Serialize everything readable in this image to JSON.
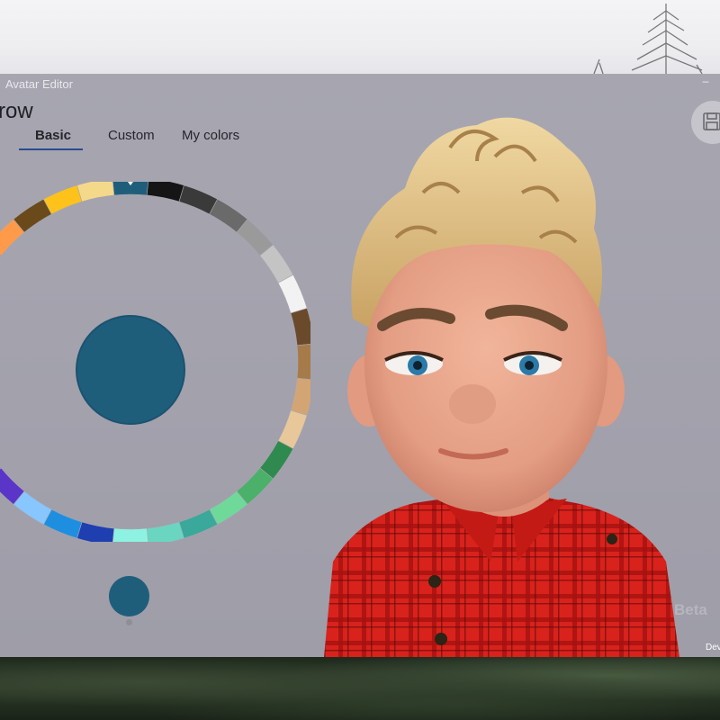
{
  "window": {
    "app_title": "Avatar Editor",
    "page_title": "rrow",
    "minimize_glyph": "–"
  },
  "tabs": [
    {
      "label": "Basic",
      "selected": true
    },
    {
      "label": "Custom",
      "selected": false
    },
    {
      "label": "My colors",
      "selected": false
    }
  ],
  "color_picker": {
    "selected_color": "#1f5e7b",
    "swatches": [
      "#1f5e7b",
      "#151515",
      "#3a3a3a",
      "#6a6a6a",
      "#9a9a9a",
      "#c4c4c4",
      "#f2f2f2",
      "#6a4a2a",
      "#a67b4a",
      "#d4a574",
      "#e8c89a",
      "#2f8a4f",
      "#4bb06a",
      "#6fd99a",
      "#3aa89a",
      "#6ad6c2",
      "#8ef2e2",
      "#1f3fb0",
      "#1e8fe0",
      "#88c6ff",
      "#5a35c8",
      "#8b6cf2",
      "#b59cf8",
      "#c22bc8",
      "#ff2ba8",
      "#ff4e6e",
      "#e02a2a",
      "#ff6a1a",
      "#ff9a4a",
      "#6a4a1a",
      "#ffc21a",
      "#f5d98a"
    ]
  },
  "avatar": {
    "item": "avatar-preview",
    "hair_color": "#e8c98c",
    "shirt_color": "#d9221c"
  },
  "overlay": {
    "beta": "Beta",
    "dev": "Dev"
  }
}
